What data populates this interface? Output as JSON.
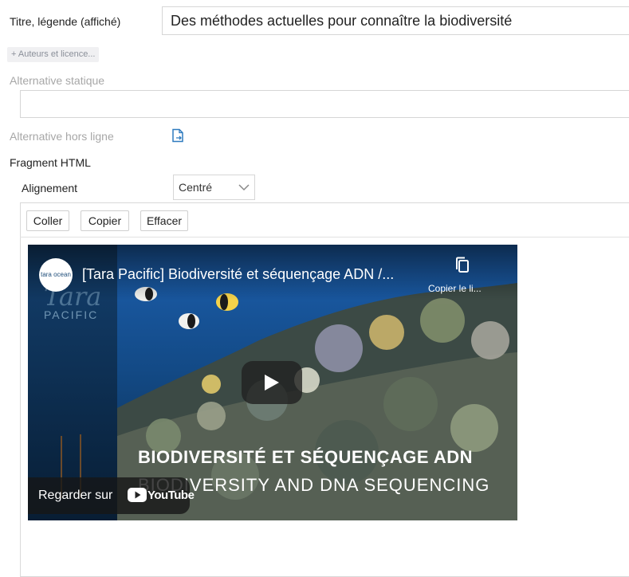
{
  "form": {
    "title_label": "Titre, légende (affiché)",
    "title_value": "Des méthodes actuelles pour connaître la biodiversité",
    "authors_link": "+ Auteurs et licence...",
    "static_alt_label": "Alternative statique",
    "static_alt_value": "",
    "offline_alt_label": "Alternative hors ligne",
    "fragment_label": "Fragment HTML",
    "alignment_label": "Alignement",
    "alignment_value": "Centré"
  },
  "toolbar": {
    "paste_label": "Coller",
    "copy_label": "Copier",
    "clear_label": "Effacer"
  },
  "video": {
    "title": "[Tara Pacific] Biodiversité et séquençage ADN /...",
    "channel_logo_text": "tara ocean",
    "copy_link_label": "Copier le li...",
    "overlay_line_1": "BIODIVERSITÉ ET SÉQUENÇAGE ADN",
    "overlay_line_2": "BIODIVERSITY AND DNA SEQUENCING",
    "watermark_1": "Tara",
    "watermark_2": "PACIFIC",
    "watch_on_label": "Regarder sur",
    "youtube_label": "YouTube"
  },
  "colors": {
    "border": "#d6d6d6",
    "muted_text": "#a7a7a7",
    "link_grey": "#8a8f99",
    "offline_icon": "#2f7bbf",
    "youtube_red": "#ff0000"
  }
}
